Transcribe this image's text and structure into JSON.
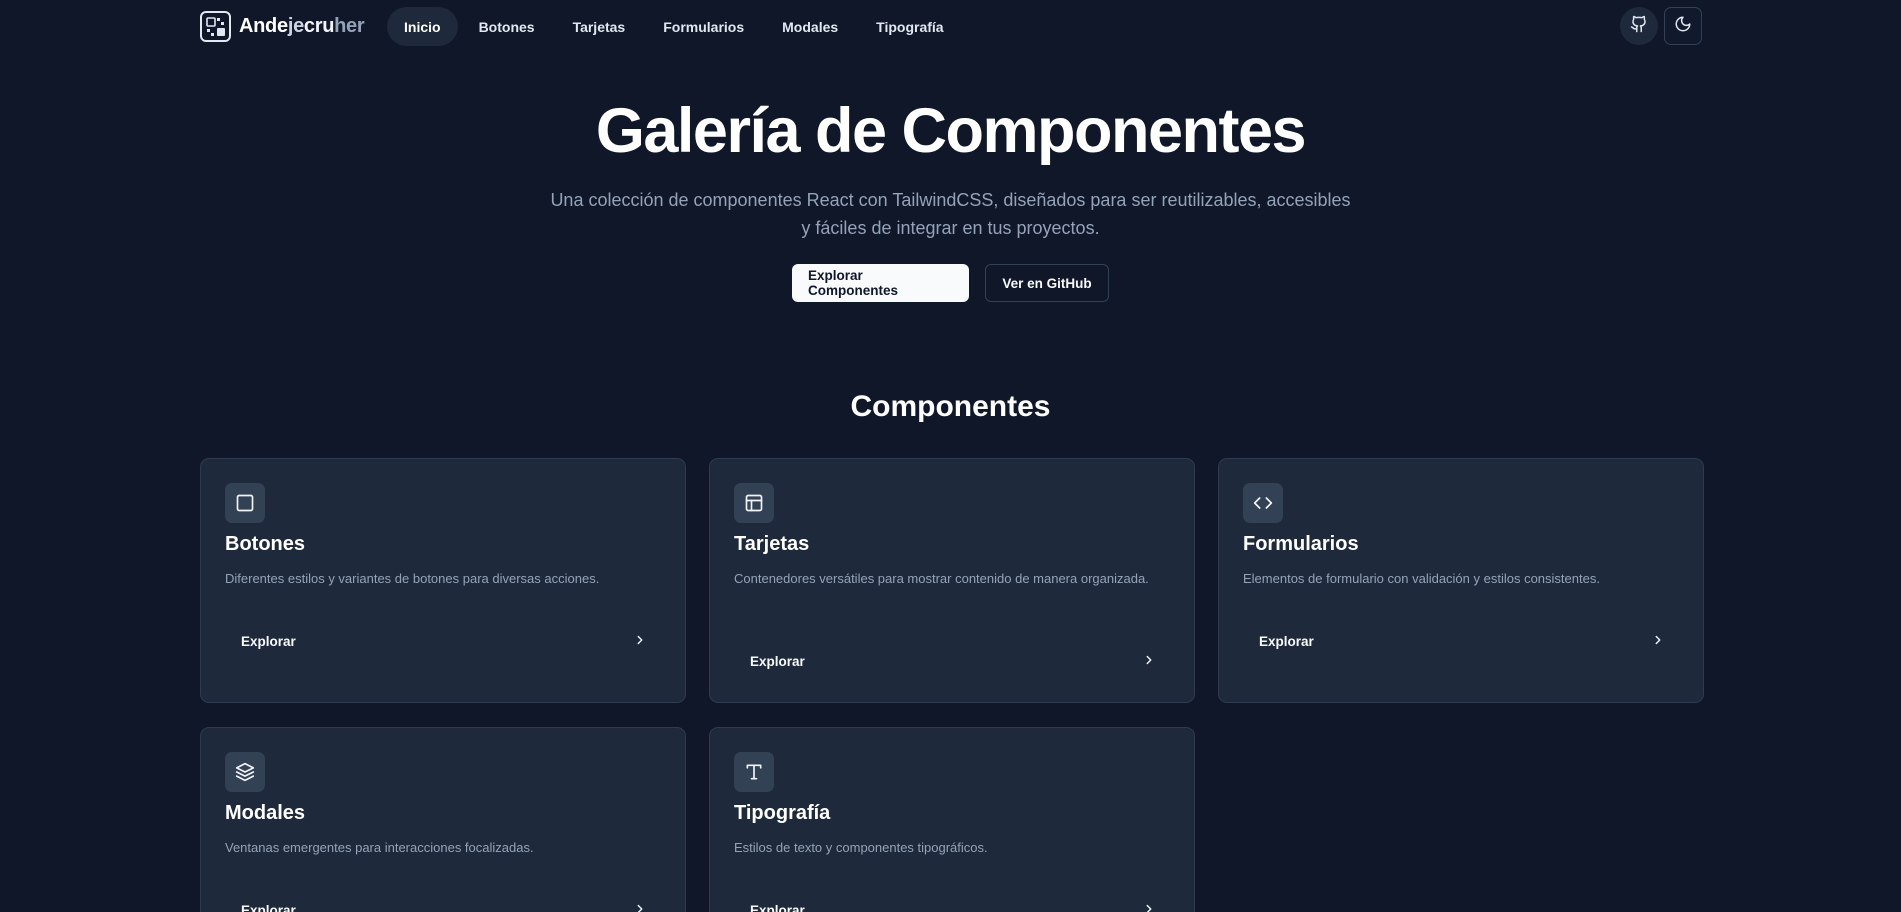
{
  "brand": {
    "part1": "Ande",
    "part2": "je",
    "part3": "cru",
    "part4": "her"
  },
  "nav": {
    "items": [
      {
        "label": "Inicio",
        "active": true
      },
      {
        "label": "Botones"
      },
      {
        "label": "Tarjetas"
      },
      {
        "label": "Formularios"
      },
      {
        "label": "Modales"
      },
      {
        "label": "Tipografía"
      }
    ],
    "github_icon": "github-icon",
    "theme_icon": "moon-icon"
  },
  "hero": {
    "title": "Galería de Componentes",
    "subtitle": "Una colección de componentes React con TailwindCSS, diseñados para ser reutilizables, accesibles y fáciles de integrar en tus proyectos.",
    "primary_label": "Explorar Componentes",
    "secondary_label": "Ver en GitHub"
  },
  "section": {
    "title": "Componentes"
  },
  "cards": [
    {
      "icon": "square-icon",
      "title": "Botones",
      "description": "Diferentes estilos y variantes de botones para diversas acciones.",
      "link": "Explorar"
    },
    {
      "icon": "layout-icon",
      "title": "Tarjetas",
      "description": "Contenedores versátiles para mostrar contenido de manera organizada.",
      "link": "Explorar"
    },
    {
      "icon": "code-icon",
      "title": "Formularios",
      "description": "Elementos de formulario con validación y estilos consistentes.",
      "link": "Explorar"
    },
    {
      "icon": "layers-icon",
      "title": "Modales",
      "description": "Ventanas emergentes para interacciones focalizadas.",
      "link": "Explorar"
    },
    {
      "icon": "type-icon",
      "title": "Tipografía",
      "description": "Estilos de texto y componentes tipográficos.",
      "link": "Explorar"
    }
  ],
  "colors": {
    "background": "#0f1729",
    "card": "#1e293b",
    "muted_text": "#94a3b8",
    "primary_button": "#f8fafc"
  }
}
